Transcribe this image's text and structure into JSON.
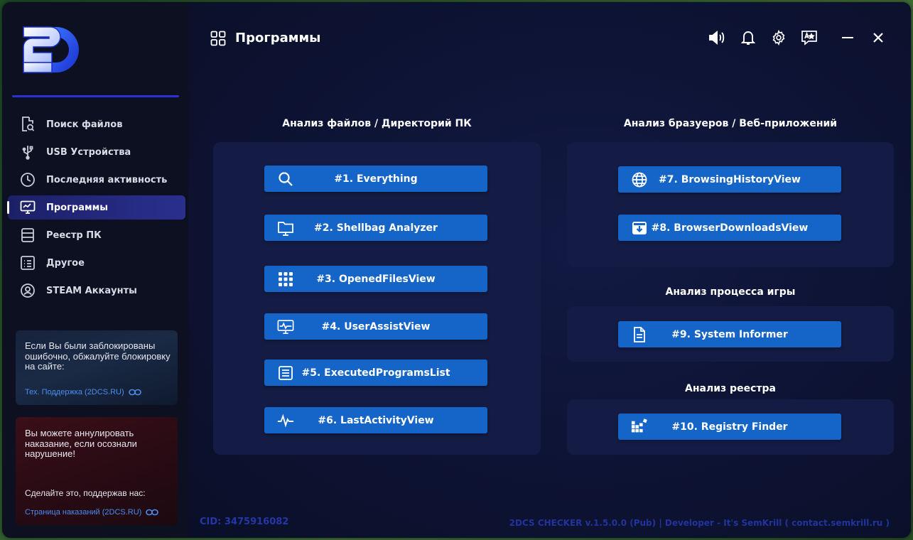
{
  "app": {
    "page_title": "Программы"
  },
  "sidebar": {
    "items": [
      {
        "label": "Поиск файлов",
        "icon": "file-search-icon",
        "active": false
      },
      {
        "label": "USB Устройства",
        "icon": "usb-icon",
        "active": false
      },
      {
        "label": "Последняя активность",
        "icon": "clock-icon",
        "active": false
      },
      {
        "label": "Программы",
        "icon": "monitor-icon",
        "active": true
      },
      {
        "label": "Реестр ПК",
        "icon": "database-icon",
        "active": false
      },
      {
        "label": "Другое",
        "icon": "list-icon",
        "active": false
      },
      {
        "label": "STEAM Аккаунты",
        "icon": "user-circle-icon",
        "active": false
      }
    ],
    "card_blocked": {
      "text": "Если Вы были заблокированы ошибочно, обжалуйте блокировку на сайте:",
      "link": "Тех. Поддержка (2DCS.RU)"
    },
    "card_punish": {
      "text": "Вы можете аннулировать наказание, если осознали нарушение!",
      "text2": "Сделайте это, поддержав нас:",
      "link": "Страница наказаний (2DCS.RU)"
    }
  },
  "sections": {
    "files": {
      "title": "Анализ файлов / Директорий ПК",
      "buttons": [
        {
          "label": "#1. Everything",
          "icon": "search-icon"
        },
        {
          "label": "#2. Shellbag Analyzer",
          "icon": "folder-icon"
        },
        {
          "label": "#3. OpenedFilesView",
          "icon": "grid-dots-icon"
        },
        {
          "label": "#4. UserAssistView",
          "icon": "monitor-pulse-icon"
        },
        {
          "label": "#5. ExecutedProgramsList",
          "icon": "document-list-icon"
        },
        {
          "label": "#6. LastActivityView",
          "icon": "activity-icon"
        }
      ]
    },
    "browsers": {
      "title": "Анализ бразуеров / Веб-приложений",
      "buttons": [
        {
          "label": "#7. BrowsingHistoryView",
          "icon": "globe-icon"
        },
        {
          "label": "#8. BrowserDownloadsView",
          "icon": "download-box-icon"
        }
      ]
    },
    "game": {
      "title": "Анализ процесса игры",
      "buttons": [
        {
          "label": "#9. System Informer",
          "icon": "file-text-icon"
        }
      ]
    },
    "registry": {
      "title": "Анализ реестра",
      "buttons": [
        {
          "label": "#10. Registry Finder",
          "icon": "registry-icon"
        }
      ]
    }
  },
  "footer": {
    "cid": "CID: 3475916082",
    "developer": "2DCS CHECKER v.1.5.0.0 (Pub) | Developer - It's SemKrill ( contact.semkrill.ru )"
  },
  "colors": {
    "accent": "#1565c8",
    "nav_active": "#2a2f8f",
    "logo_line": "#2b2fd6"
  }
}
